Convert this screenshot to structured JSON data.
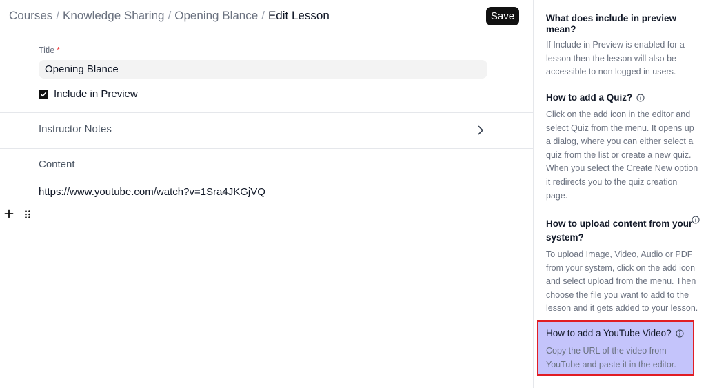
{
  "breadcrumb": {
    "items": [
      "Courses",
      "Knowledge Sharing",
      "Opening Blance"
    ],
    "separator": "/",
    "current": "Edit Lesson"
  },
  "toolbar": {
    "save_label": "Save"
  },
  "form": {
    "title_label": "Title",
    "required_mark": "*",
    "title_value": "Opening Blance",
    "include_preview_label": "Include in Preview",
    "include_preview_checked": true,
    "instructor_notes_label": "Instructor Notes",
    "content_label": "Content",
    "content_text": "https://www.youtube.com/watch?v=1Sra4JKGjVQ"
  },
  "icons": {
    "check": "check-icon",
    "chevron": "chevron-right-icon",
    "add": "plus-icon",
    "drag": "drag-handle-icon",
    "info": "info-icon"
  },
  "colors": {
    "accent": "#111111",
    "highlight_bg": "#c4c4fb",
    "highlight_border": "#e11d24",
    "required": "#ef4444"
  },
  "help": {
    "preview": {
      "title_line1": "What does include in preview",
      "title_line2": "mean?",
      "lines": [
        "If Include in Preview is enabled for a",
        "lesson then the lesson will also be",
        "accessible to non logged in users."
      ]
    },
    "quiz": {
      "title": "How to add a Quiz?",
      "lines": [
        "Click on the add icon in the editor and",
        "select Quiz from the menu. It opens up",
        "a dialog, where you can either select a",
        "quiz from the list or create a new quiz.",
        "When you select the Create New option",
        "it redirects you to the quiz creation",
        "page."
      ]
    },
    "upload": {
      "title_line1": "How to upload content from your",
      "title_line2": "system?",
      "lines": [
        "To upload Image, Video, Audio or PDF",
        "from your system, click on the add icon",
        "and select upload from the menu. Then",
        "choose the file you want to add to the",
        "lesson and it gets added to your lesson."
      ]
    },
    "youtube": {
      "title": "How to add a YouTube Video?",
      "lines": [
        "Copy the URL of the video from",
        "YouTube and paste it in the editor."
      ]
    }
  }
}
